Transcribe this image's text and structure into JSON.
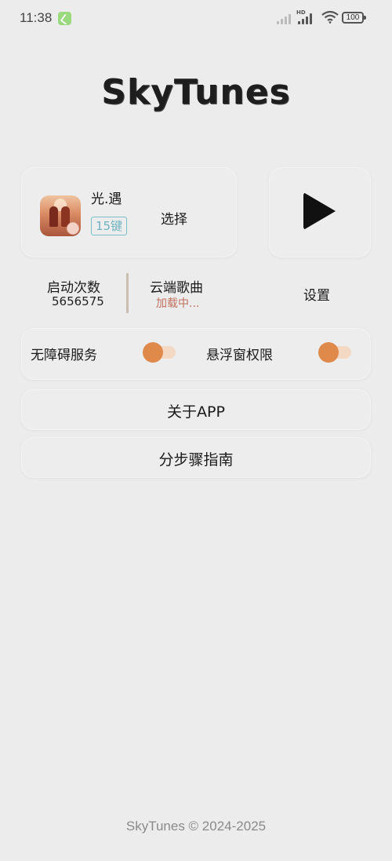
{
  "status_bar": {
    "time": "11:38",
    "hd_label": "HD",
    "battery": "100"
  },
  "app": {
    "title": "SkyTunes"
  },
  "game_card": {
    "name": "光.遇",
    "keys_badge": "15键",
    "select_label": "选择"
  },
  "play": {
    "icon": "play-icon"
  },
  "stats": {
    "launch_label": "启动次数",
    "launch_value": "5656575",
    "cloud_label": "云端歌曲",
    "cloud_status": "加载中..."
  },
  "settings_label": "设置",
  "permissions": {
    "accessibility_label": "无障碍服务",
    "accessibility_enabled": false,
    "overlay_label": "悬浮窗权限",
    "overlay_enabled": false
  },
  "buttons": {
    "about": "关于APP",
    "guide": "分步骤指南"
  },
  "footer": "SkyTunes © 2024-2025",
  "colors": {
    "accent": "#df8a4a",
    "badge": "#6fb3c2",
    "loading": "#c0705e"
  }
}
